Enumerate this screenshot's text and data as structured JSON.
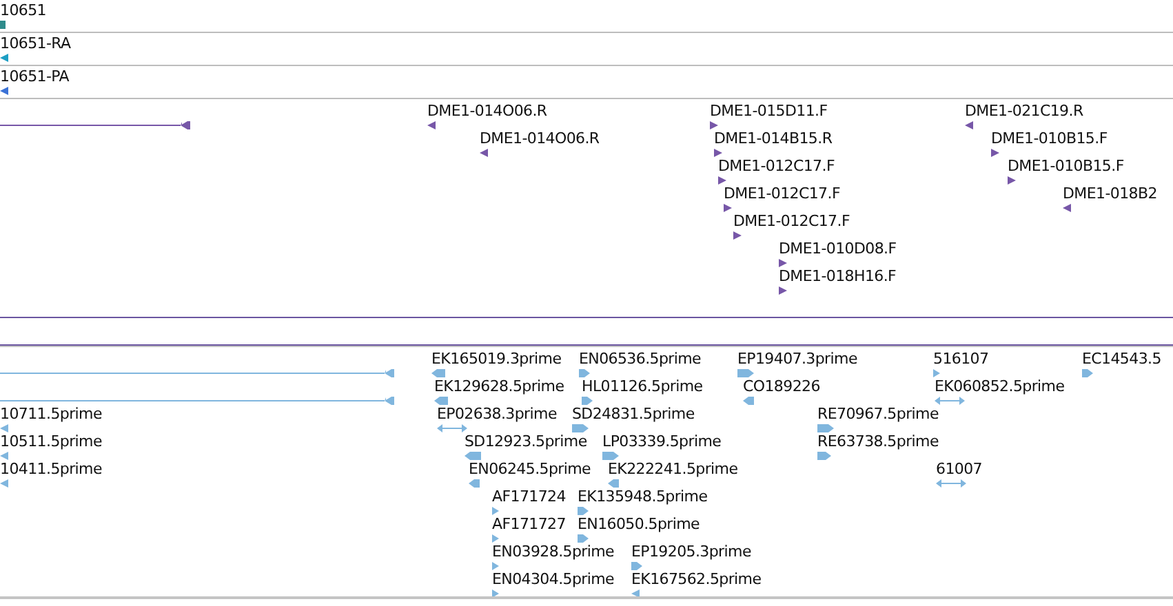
{
  "tracks": [
    {
      "kind": "small",
      "color": "#2e8b8b",
      "features": [
        {
          "label": "10651",
          "kind": "block"
        }
      ]
    },
    {
      "kind": "small",
      "color": "#1d9fc4",
      "features": [
        {
          "label": "10651-RA",
          "kind": "left"
        }
      ]
    },
    {
      "kind": "small",
      "color": "#3b72d6",
      "features": [
        {
          "label": "10651-PA",
          "kind": "left"
        }
      ]
    },
    {
      "kind": "large",
      "color": "#7757a8",
      "features": [
        {
          "kind": "line"
        },
        {
          "label": "DME1-014O06.R",
          "kind": "left"
        },
        {
          "label": "DME1-014O06.R",
          "kind": "left"
        },
        {
          "label": "DME1-015D11.F",
          "kind": "right"
        },
        {
          "label": "DME1-014B15.R",
          "kind": "right"
        },
        {
          "label": "DME1-012C17.F",
          "kind": "right"
        },
        {
          "label": "DME1-012C17.F",
          "kind": "right"
        },
        {
          "label": "DME1-012C17.F",
          "kind": "right"
        },
        {
          "label": "DME1-010D08.F",
          "kind": "right"
        },
        {
          "label": "DME1-018H16.F",
          "kind": "right"
        },
        {
          "label": "DME1-021C19.R",
          "kind": "left"
        },
        {
          "label": "DME1-010B15.F",
          "kind": "right"
        },
        {
          "label": "DME1-010B15.F",
          "kind": "right"
        },
        {
          "label": "DME1-018B2",
          "kind": "left"
        }
      ]
    },
    {
      "kind": "large",
      "color": "#80b6de",
      "features": [
        {
          "kind": "line"
        },
        {
          "kind": "line"
        },
        {
          "label": "10711.5prime",
          "kind": "left"
        },
        {
          "label": "10511.5prime",
          "kind": "left"
        },
        {
          "label": "10411.5prime",
          "kind": "left"
        },
        {
          "label": "EK165019.3prime",
          "kind": "left"
        },
        {
          "label": "EK129628.5prime",
          "kind": "left"
        },
        {
          "label": "EP02638.3prime",
          "kind": "both"
        },
        {
          "label": "SD12923.5prime",
          "kind": "left"
        },
        {
          "label": "EN06245.5prime",
          "kind": "left"
        },
        {
          "label": "AF171724",
          "kind": "right"
        },
        {
          "label": "AF171727",
          "kind": "right"
        },
        {
          "label": "EN03928.5prime",
          "kind": "right"
        },
        {
          "label": "EN04304.5prime",
          "kind": "right"
        },
        {
          "label": "EN06536.5prime",
          "kind": "right"
        },
        {
          "label": "HL01126.5prime",
          "kind": "right"
        },
        {
          "label": "SD24831.5prime",
          "kind": "right"
        },
        {
          "label": "LP03339.5prime",
          "kind": "right"
        },
        {
          "label": "EK222241.5prime",
          "kind": "left"
        },
        {
          "label": "EK135948.5prime",
          "kind": "right"
        },
        {
          "label": "EN16050.5prime",
          "kind": "right"
        },
        {
          "label": "EP19205.3prime",
          "kind": "right"
        },
        {
          "label": "EK167562.5prime",
          "kind": "left"
        },
        {
          "label": "EP19407.3prime",
          "kind": "right"
        },
        {
          "label": "CO189226",
          "kind": "left"
        },
        {
          "label": "RE70967.5prime",
          "kind": "right"
        },
        {
          "label": "RE63738.5prime",
          "kind": "right"
        },
        {
          "label": "516107",
          "kind": "right"
        },
        {
          "label": "EK060852.5prime",
          "kind": "both"
        },
        {
          "label": "61007",
          "kind": "both"
        },
        {
          "label": "EC14543.5",
          "kind": "right"
        }
      ]
    }
  ]
}
